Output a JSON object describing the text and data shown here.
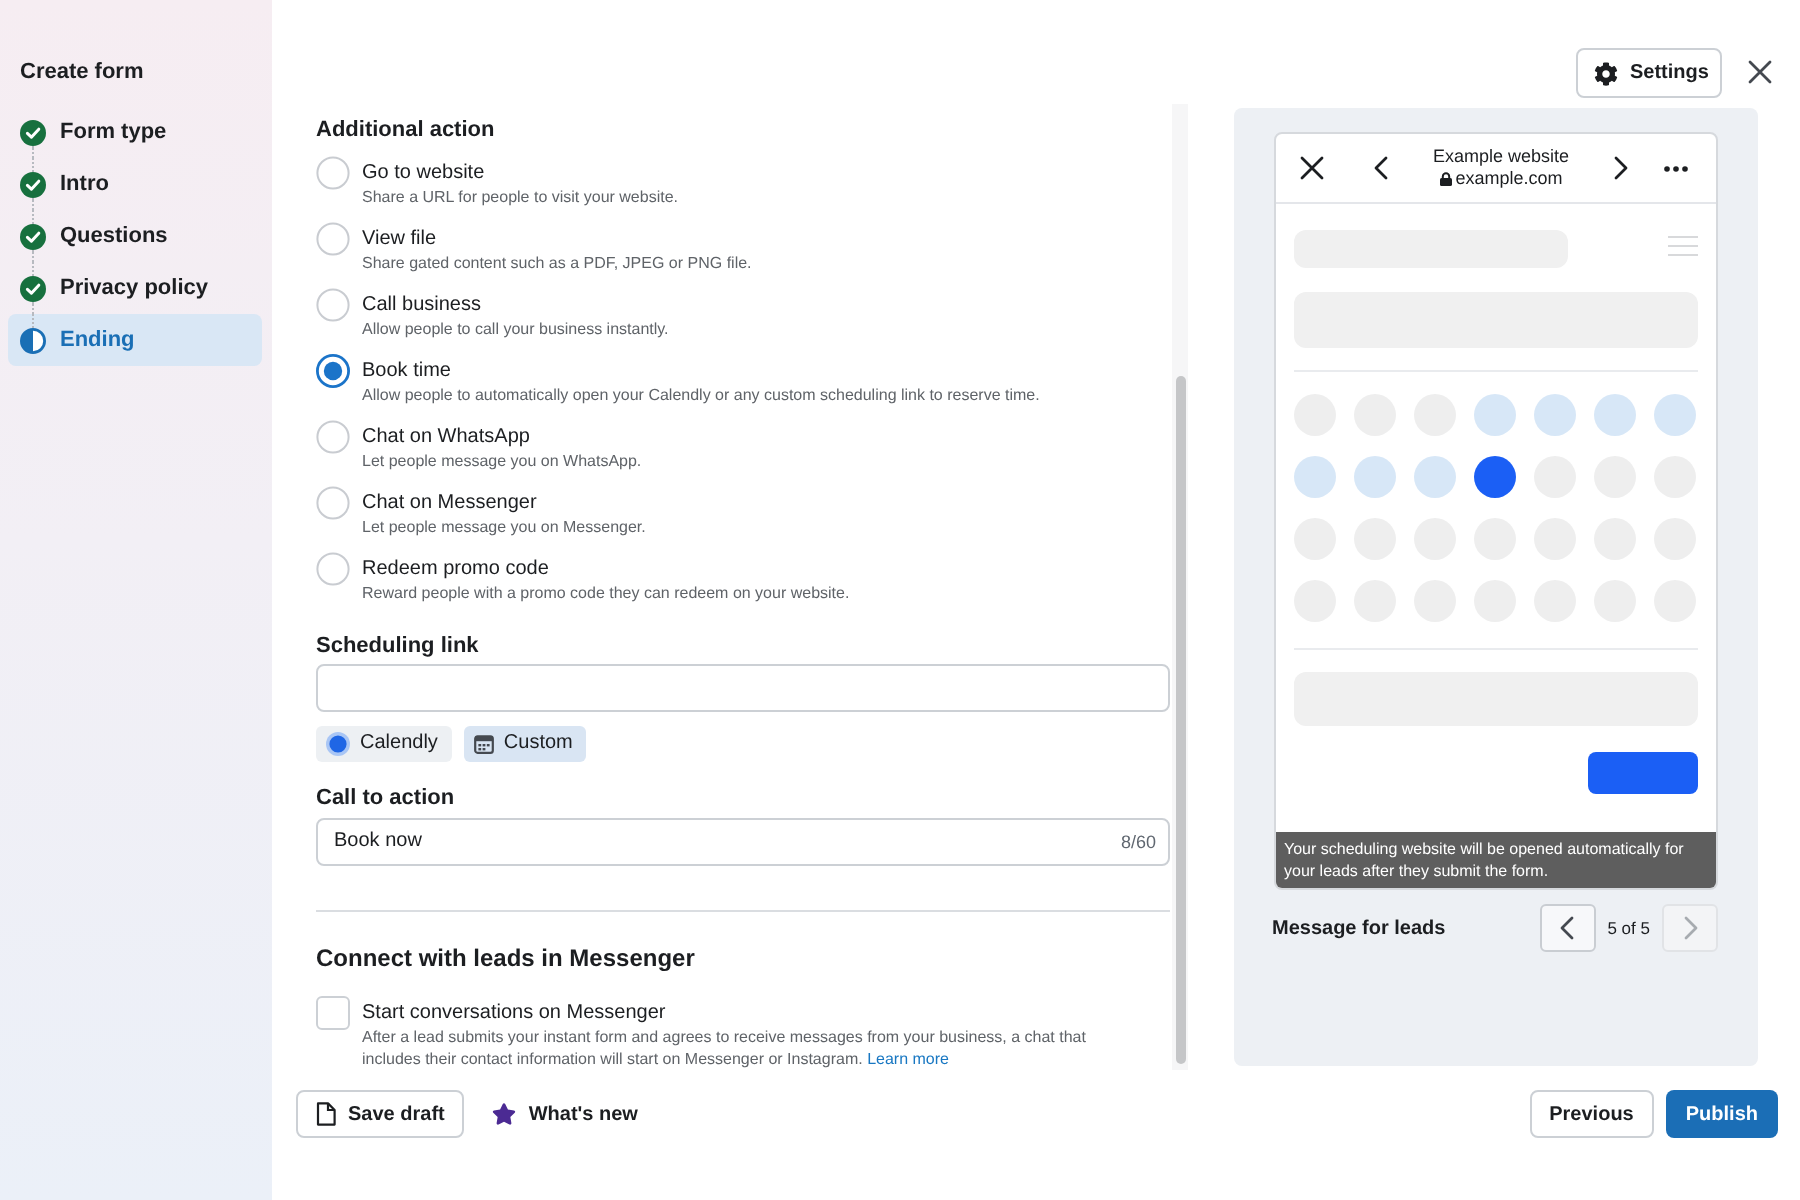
{
  "header": {
    "settings_button": "Settings"
  },
  "sidebar": {
    "title": "Create form",
    "steps": [
      {
        "label": "Form type",
        "completed": true,
        "selected": false
      },
      {
        "label": "Intro",
        "completed": true,
        "selected": false
      },
      {
        "label": "Questions",
        "completed": true,
        "selected": false
      },
      {
        "label": "Privacy policy",
        "completed": true,
        "selected": false
      },
      {
        "label": "Ending",
        "completed": false,
        "selected": true
      }
    ]
  },
  "additional_action": {
    "title": "Additional action",
    "options": [
      {
        "label": "Go to website",
        "description": "Share a URL for people to visit your website.",
        "selected": false
      },
      {
        "label": "View file",
        "description": "Share gated content such as a PDF, JPEG or PNG file.",
        "selected": false
      },
      {
        "label": "Call business",
        "description": "Allow people to call your business instantly.",
        "selected": false
      },
      {
        "label": "Book time",
        "description": "Allow people to automatically open your Calendly or any custom scheduling link to reserve time.",
        "selected": true
      },
      {
        "label": "Chat on WhatsApp",
        "description": "Let people message you on WhatsApp.",
        "selected": false
      },
      {
        "label": "Chat on Messenger",
        "description": "Let people message you on Messenger.",
        "selected": false
      },
      {
        "label": "Redeem promo code",
        "description": "Reward people with a promo code they can redeem on your website.",
        "selected": false
      }
    ]
  },
  "scheduling_link": {
    "label": "Scheduling link",
    "providers": [
      {
        "label": "Calendly",
        "kind": "calendly",
        "selected": false
      },
      {
        "label": "Custom",
        "kind": "custom",
        "selected": true
      }
    ]
  },
  "call_to_action": {
    "label": "Call to action",
    "value": "Book now",
    "counter": "8/60"
  },
  "messenger": {
    "title": "Connect with leads in Messenger",
    "option": {
      "label": "Start conversations on Messenger",
      "checked": false,
      "description": "After a lead submits your instant form and agrees to receive messages from your business, a chat that includes their contact information will start on Messenger or Instagram.",
      "link": "Learn more"
    }
  },
  "preview": {
    "browser": {
      "title": "Example website",
      "url": "example.com"
    },
    "calendar_days": [
      {
        "kind": "empty"
      },
      {
        "kind": "empty"
      },
      {
        "kind": "empty"
      },
      {
        "kind": "range"
      },
      {
        "kind": "range"
      },
      {
        "kind": "range"
      },
      {
        "kind": "range"
      },
      {
        "kind": "range"
      },
      {
        "kind": "range"
      },
      {
        "kind": "range"
      },
      {
        "kind": "selected"
      },
      {
        "kind": "empty"
      },
      {
        "kind": "empty"
      },
      {
        "kind": "empty"
      },
      {
        "kind": "empty"
      },
      {
        "kind": "empty"
      },
      {
        "kind": "empty"
      },
      {
        "kind": "empty"
      },
      {
        "kind": "empty"
      },
      {
        "kind": "empty"
      },
      {
        "kind": "empty"
      },
      {
        "kind": "empty"
      },
      {
        "kind": "empty"
      },
      {
        "kind": "empty"
      },
      {
        "kind": "empty"
      },
      {
        "kind": "empty"
      },
      {
        "kind": "empty"
      },
      {
        "kind": "empty"
      }
    ],
    "tooltip": "Your scheduling website will be opened automatically for your leads after they submit the form.",
    "caption": "Message for leads",
    "pager": {
      "text": "5 of 5",
      "previous_disabled": false,
      "next_disabled": true
    }
  },
  "footer": {
    "save_draft": "Save draft",
    "whats_new": "What's new",
    "previous": "Previous",
    "publish": "Publish"
  }
}
